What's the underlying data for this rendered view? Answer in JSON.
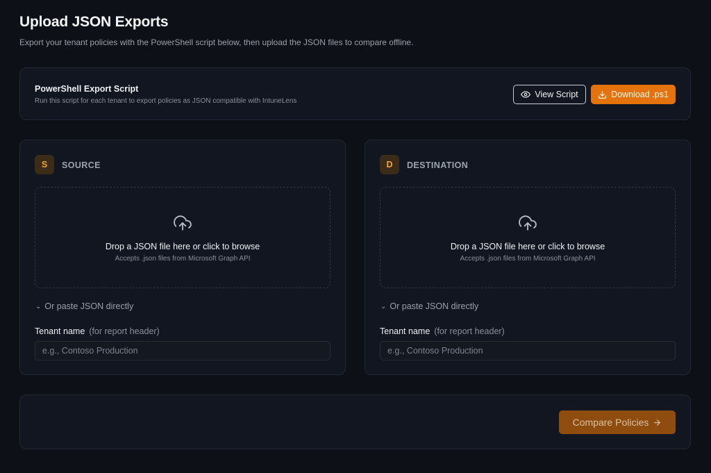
{
  "header": {
    "title": "Upload JSON Exports",
    "subtitle": "Export your tenant policies with the PowerShell script below, then upload the JSON files to compare offline."
  },
  "script_card": {
    "title": "PowerShell Export Script",
    "description": "Run this script for each tenant to export policies as JSON compatible with IntuneLens",
    "view_button": "View Script",
    "view_icon": "eye-icon",
    "download_button": "Download .ps1",
    "download_icon": "download-icon"
  },
  "panels": [
    {
      "badge": "S",
      "label": "SOURCE",
      "drop_title": "Drop a JSON file here or click to browse",
      "drop_subtitle": "Accepts .json files from Microsoft Graph API",
      "paste_toggle": "Or paste JSON directly",
      "tenant_label": "Tenant name",
      "tenant_hint": "(for report header)",
      "tenant_placeholder": "e.g., Contoso Production"
    },
    {
      "badge": "D",
      "label": "DESTINATION",
      "drop_title": "Drop a JSON file here or click to browse",
      "drop_subtitle": "Accepts .json files from Microsoft Graph API",
      "paste_toggle": "Or paste JSON directly",
      "tenant_label": "Tenant name",
      "tenant_hint": "(for report header)",
      "tenant_placeholder": "e.g., Contoso Production"
    }
  ],
  "footer": {
    "compare_button": "Compare Policies",
    "compare_icon": "arrow-right-icon"
  },
  "colors": {
    "accent": "#e4730d",
    "accent_disabled": "#8e4d0f",
    "badge_bg": "#3a2c16",
    "badge_text": "#eea53a",
    "background": "#0d1017",
    "card": "#121620"
  }
}
